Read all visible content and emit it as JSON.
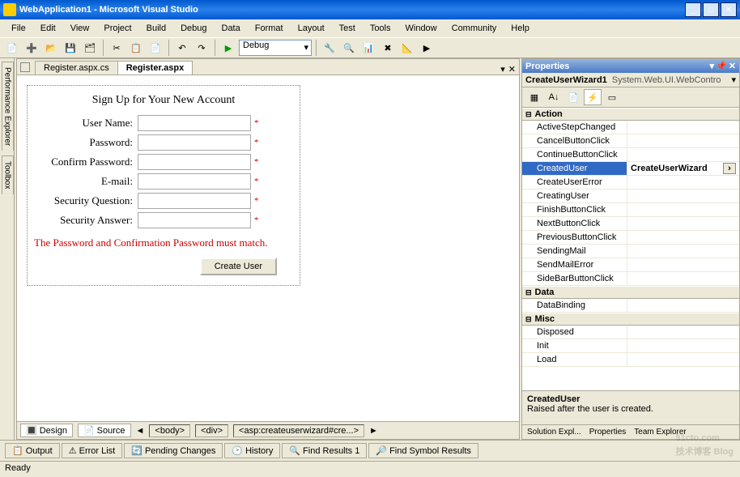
{
  "window": {
    "title": "WebApplication1 - Microsoft Visual Studio"
  },
  "menu": [
    "File",
    "Edit",
    "View",
    "Project",
    "Build",
    "Debug",
    "Data",
    "Format",
    "Layout",
    "Test",
    "Tools",
    "Window",
    "Community",
    "Help"
  ],
  "toolbar": {
    "config": "Debug"
  },
  "tabs": {
    "t1": "Register.aspx.cs",
    "t2": "Register.aspx"
  },
  "leftTabs": [
    "Performance Explorer",
    "Toolbox"
  ],
  "wizard": {
    "heading": "Sign Up for Your New Account",
    "username": "User Name:",
    "password": "Password:",
    "confirm": "Confirm Password:",
    "email": "E-mail:",
    "question": "Security Question:",
    "answer": "Security Answer:",
    "error": "The Password and Confirmation Password must match.",
    "submit": "Create User"
  },
  "views": {
    "design": "Design",
    "source": "Source"
  },
  "crumbs": [
    "<body>",
    "<div>",
    "<asp:createuserwizard#cre...>"
  ],
  "props": {
    "title": "Properties",
    "object": "CreateUserWizard1",
    "type": "System.Web.UI.WebContro",
    "cats": {
      "action": "Action",
      "data": "Data",
      "misc": "Misc"
    },
    "action": [
      "ActiveStepChanged",
      "CancelButtonClick",
      "ContinueButtonClick",
      "CreatedUser",
      "CreateUserError",
      "CreatingUser",
      "FinishButtonClick",
      "NextButtonClick",
      "PreviousButtonClick",
      "SendingMail",
      "SendMailError",
      "SideBarButtonClick"
    ],
    "selectedValue": "CreateUserWizard",
    "data": [
      "DataBinding"
    ],
    "misc": [
      "Disposed",
      "Init",
      "Load"
    ],
    "descTitle": "CreatedUser",
    "descBody": "Raised after the user is created."
  },
  "propTabs": [
    "Solution Expl...",
    "Properties",
    "Team Explorer"
  ],
  "bottom": [
    "Output",
    "Error List",
    "Pending Changes",
    "History",
    "Find Results 1",
    "Find Symbol Results"
  ],
  "status": "Ready",
  "watermark": {
    "big": "51cto.com",
    "small": "技术博客  Blog"
  }
}
